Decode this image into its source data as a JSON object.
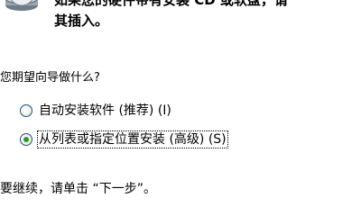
{
  "intro": {
    "line1": "如果您的硬件带有安装 CD 或软盘，请",
    "line2": "其插入。"
  },
  "question": "您期望向导做什么?",
  "options": [
    {
      "label": "自动安装软件 (推荐) (I)",
      "selected": false,
      "icon": "radio-unselected"
    },
    {
      "label": "从列表或指定位置安装 (高级) (S)",
      "selected": true,
      "icon": "radio-selected"
    }
  ],
  "continue_text": "要继续，请单击 “下一步”。",
  "colors": {
    "background": "#ffffff",
    "radio_border": "#1c5180",
    "radio_dot": "#21a121"
  },
  "header_icon": "cd-drive-icon"
}
